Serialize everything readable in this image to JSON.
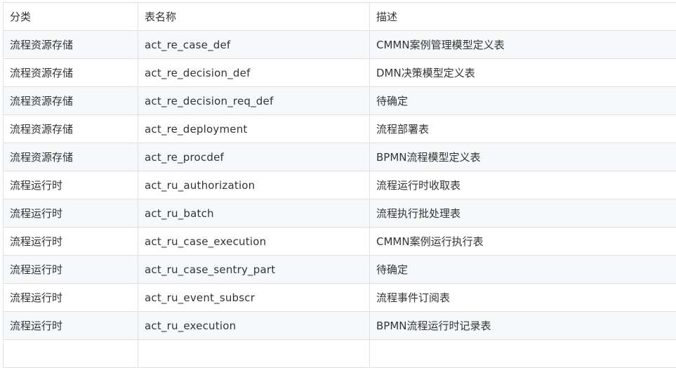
{
  "table": {
    "headers": [
      "分类",
      "表名称",
      "描述"
    ],
    "rows": [
      [
        "流程资源存储",
        "act_re_case_def",
        "CMMN案例管理模型定义表"
      ],
      [
        "流程资源存储",
        "act_re_decision_def",
        "DMN决策模型定义表"
      ],
      [
        "流程资源存储",
        "act_re_decision_req_def",
        "待确定"
      ],
      [
        "流程资源存储",
        "act_re_deployment",
        "流程部署表"
      ],
      [
        "流程资源存储",
        "act_re_procdef",
        "BPMN流程模型定义表"
      ],
      [
        "流程运行时",
        "act_ru_authorization",
        "流程运行时收取表"
      ],
      [
        "流程运行时",
        "act_ru_batch",
        "流程执行批处理表"
      ],
      [
        "流程运行时",
        "act_ru_case_execution",
        "CMMN案例运行执行表"
      ],
      [
        "流程运行时",
        "act_ru_case_sentry_part",
        "待确定"
      ],
      [
        "流程运行时",
        "act_ru_event_subscr",
        "流程事件订阅表"
      ],
      [
        "流程运行时",
        "act_ru_execution",
        "BPMN流程运行时记录表"
      ],
      [
        "",
        "",
        ""
      ]
    ]
  }
}
